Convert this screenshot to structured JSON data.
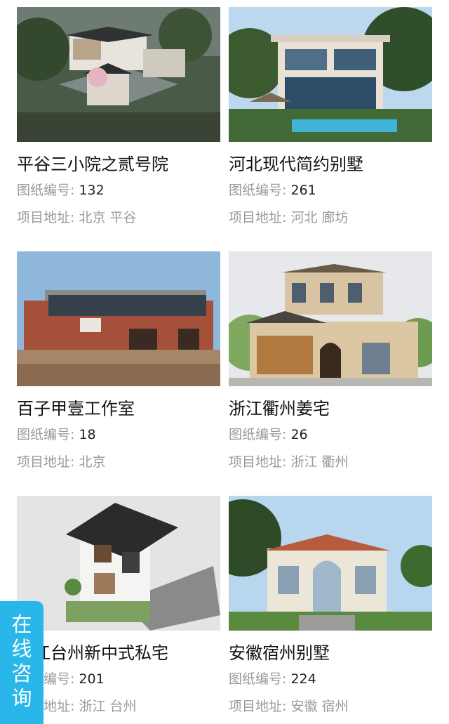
{
  "labels": {
    "code_label": "图纸编号:",
    "addr_label": "项目地址:"
  },
  "projects": [
    {
      "title": "平谷三小院之贰号院",
      "code": "132",
      "address": "北京  平谷"
    },
    {
      "title": "河北现代简约别墅",
      "code": "261",
      "address": "河北  廊坊"
    },
    {
      "title": "百子甲壹工作室",
      "code": "18",
      "address": "北京"
    },
    {
      "title": "浙江衢州姜宅",
      "code": "26",
      "address": "浙江  衢州"
    },
    {
      "title": "浙江台州新中式私宅",
      "code": "201",
      "address": "浙江  台州"
    },
    {
      "title": "安徽宿州别墅",
      "code": "224",
      "address": "安徽  宿州"
    }
  ],
  "consult": {
    "chars": [
      "在",
      "线",
      "咨",
      "询"
    ]
  },
  "colors": {
    "consult_bg": "#29b6e8",
    "meta_gray": "#9a9a9a",
    "title_black": "#111111"
  }
}
